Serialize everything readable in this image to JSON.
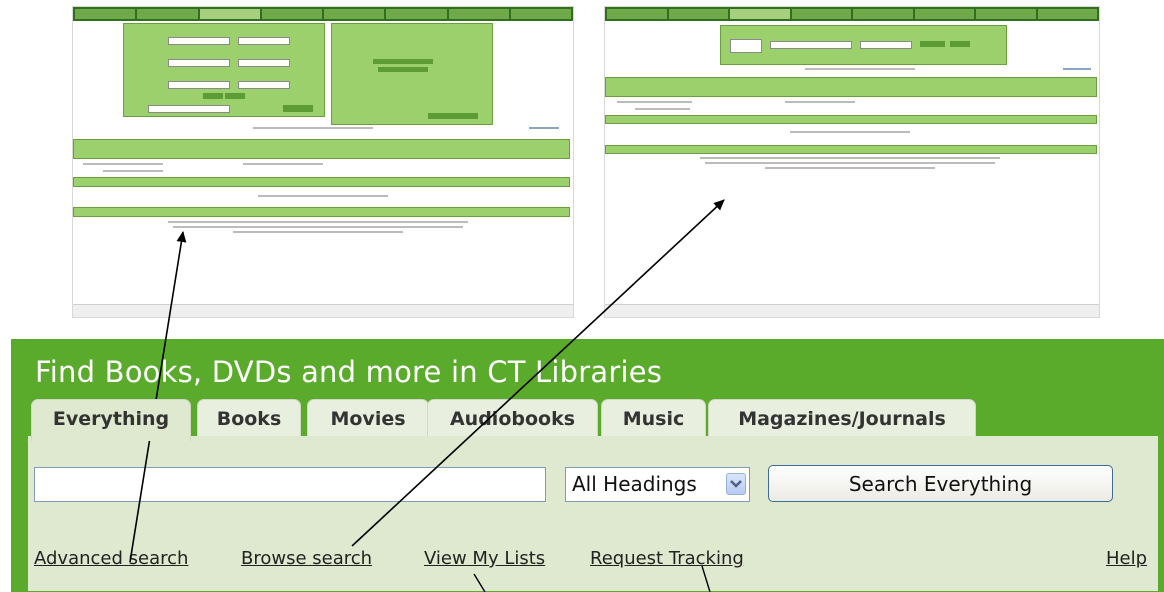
{
  "widget": {
    "title": "Find Books, DVDs and more in CT Libraries",
    "tabs": [
      {
        "label": "Everything"
      },
      {
        "label": "Books"
      },
      {
        "label": "Movies"
      },
      {
        "label": "Audiobooks"
      },
      {
        "label": "Music"
      },
      {
        "label": "Magazines/Journals"
      }
    ],
    "active_tab": "Everything",
    "search_input": {
      "value": "",
      "placeholder": ""
    },
    "heading_select": {
      "selected": "All Headings"
    },
    "search_button": "Search Everything",
    "links": {
      "advanced": "Advanced search",
      "browse": "Browse search",
      "my_lists": "View My Lists",
      "request_tracking": "Request Tracking",
      "help": "Help"
    }
  },
  "colors": {
    "widget_green": "#5aaa2b",
    "panel_bg": "#dfe9cf",
    "tab_bg": "#e9efdf",
    "arrow": "#000000"
  }
}
